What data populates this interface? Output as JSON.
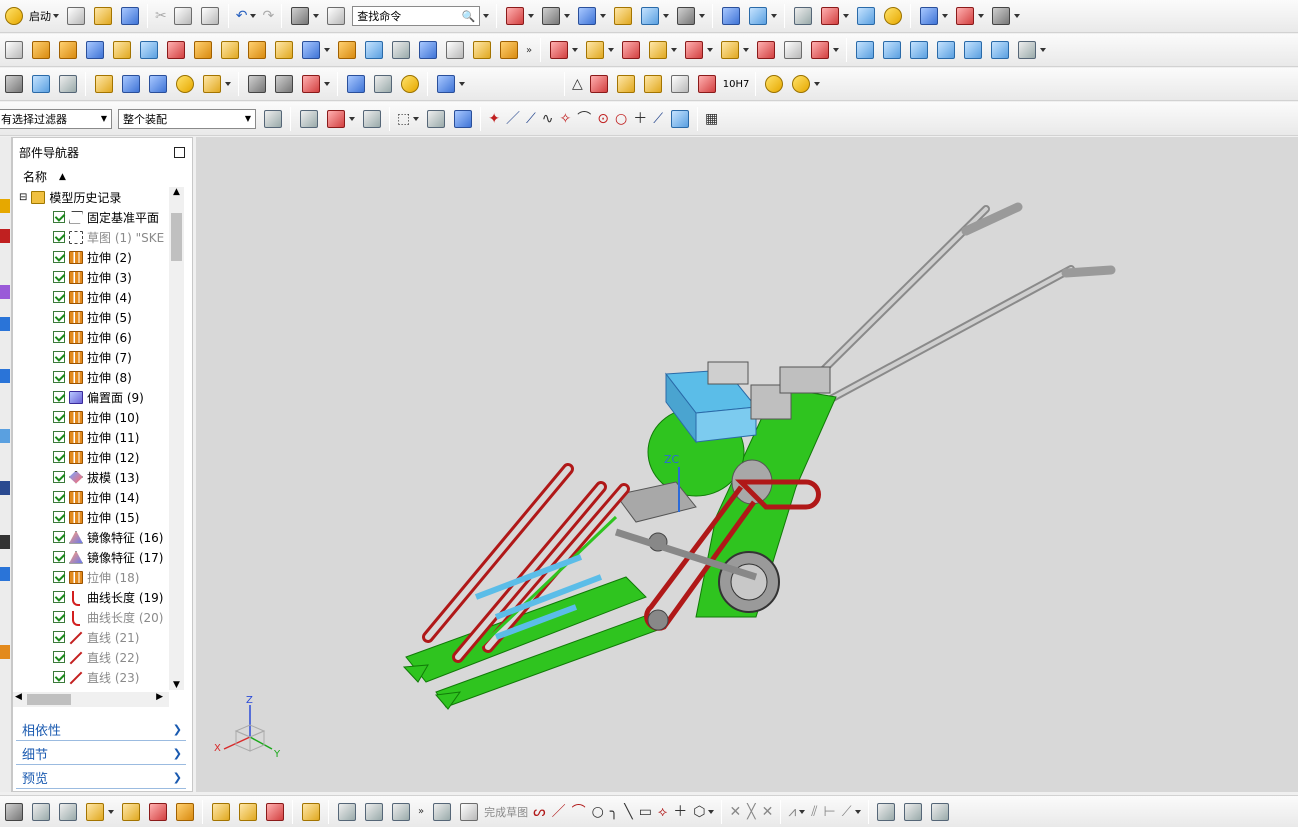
{
  "toolbar1": {
    "start_label": "启动",
    "search_placeholder": "查找命令"
  },
  "filter_bar": {
    "selection_filter": "有选择过滤器",
    "scope": "整个装配"
  },
  "navigator": {
    "title": "部件导航器",
    "column_name": "名称",
    "root": "模型历史记录",
    "items": [
      {
        "label": "固定基准平面",
        "icon": "datum-plane-icon",
        "active": true
      },
      {
        "label": "草图 (1) \"SKE",
        "icon": "sketch-icon",
        "active": false
      },
      {
        "label": "拉伸 (2)",
        "icon": "extrude-icon",
        "active": true
      },
      {
        "label": "拉伸 (3)",
        "icon": "extrude-icon",
        "active": true
      },
      {
        "label": "拉伸 (4)",
        "icon": "extrude-icon",
        "active": true
      },
      {
        "label": "拉伸 (5)",
        "icon": "extrude-icon",
        "active": true
      },
      {
        "label": "拉伸 (6)",
        "icon": "extrude-icon",
        "active": true
      },
      {
        "label": "拉伸 (7)",
        "icon": "extrude-icon",
        "active": true
      },
      {
        "label": "拉伸 (8)",
        "icon": "extrude-icon",
        "active": true
      },
      {
        "label": "偏置面 (9)",
        "icon": "offset-face-icon",
        "active": true
      },
      {
        "label": "拉伸 (10)",
        "icon": "extrude-icon",
        "active": true
      },
      {
        "label": "拉伸 (11)",
        "icon": "extrude-icon",
        "active": true
      },
      {
        "label": "拉伸 (12)",
        "icon": "extrude-icon",
        "active": true
      },
      {
        "label": "拔模 (13)",
        "icon": "draft-icon",
        "active": true
      },
      {
        "label": "拉伸 (14)",
        "icon": "extrude-icon",
        "active": true
      },
      {
        "label": "拉伸 (15)",
        "icon": "extrude-icon",
        "active": true
      },
      {
        "label": "镜像特征 (16)",
        "icon": "mirror-feature-icon",
        "active": true
      },
      {
        "label": "镜像特征 (17)",
        "icon": "mirror-feature-icon",
        "active": true
      },
      {
        "label": "拉伸 (18)",
        "icon": "extrude-icon",
        "active": false
      },
      {
        "label": "曲线长度 (19)",
        "icon": "curve-length-icon",
        "active": true
      },
      {
        "label": "曲线长度 (20)",
        "icon": "curve-length-icon",
        "active": false
      },
      {
        "label": "直线 (21)",
        "icon": "line-icon",
        "active": false
      },
      {
        "label": "直线 (22)",
        "icon": "line-icon",
        "active": false
      },
      {
        "label": "直线 (23)",
        "icon": "line-icon",
        "active": false
      }
    ],
    "panels": [
      "相依性",
      "细节",
      "预览"
    ]
  },
  "viewport": {
    "view_value": "10H7",
    "triad_x": "X",
    "triad_y": "Y",
    "triad_z": "Z",
    "model_z": "ZC"
  },
  "bottombar": {
    "finish_sketch": "完成草图"
  },
  "colors": {
    "model_green": "#2fc41f",
    "belt_red": "#b01818",
    "engine_blue": "#5bbde8",
    "viewport_bg": "#d8d8d8"
  }
}
